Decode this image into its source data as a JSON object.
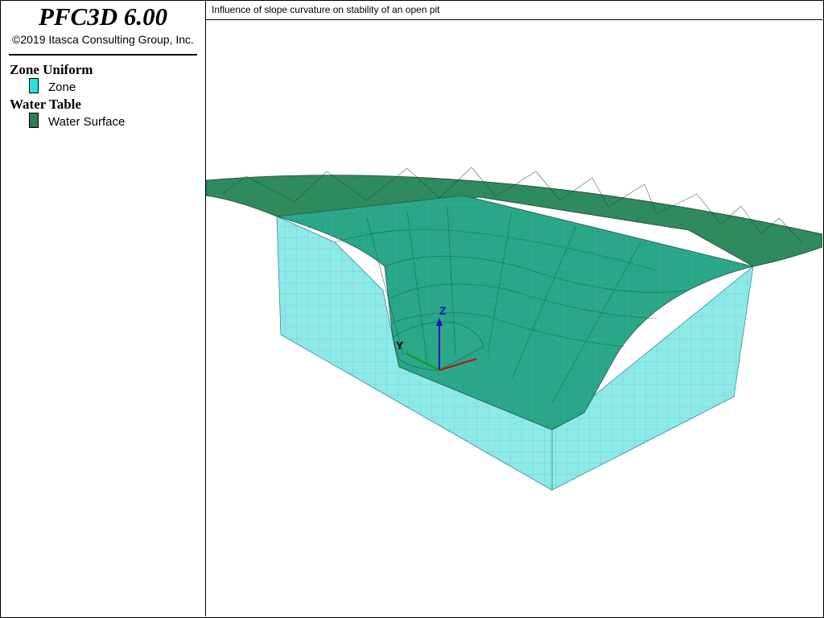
{
  "app": {
    "name": "PFC3D 6.00",
    "copyright": "©2019 Itasca Consulting Group, Inc."
  },
  "legend": {
    "groups": [
      {
        "title": "Zone Uniform",
        "items": [
          {
            "label": "Zone",
            "color": "#26e3e3"
          }
        ]
      },
      {
        "title": "Water Table",
        "items": [
          {
            "label": "Water Surface",
            "color": "#2e7d56"
          }
        ]
      }
    ]
  },
  "viewport": {
    "title": "Influence of slope curvature on stability of an open pit",
    "axes": {
      "x": "X",
      "y": "Y",
      "z": "Z"
    },
    "colors": {
      "zone_fill": "#8ee9e9",
      "zone_mesh": "#4a9a9a",
      "water_fill": "#2f8a5e",
      "pit_fill": "#2aa889",
      "axis_x": "#c01010",
      "axis_y": "#10a010",
      "axis_z": "#1010c0"
    }
  }
}
